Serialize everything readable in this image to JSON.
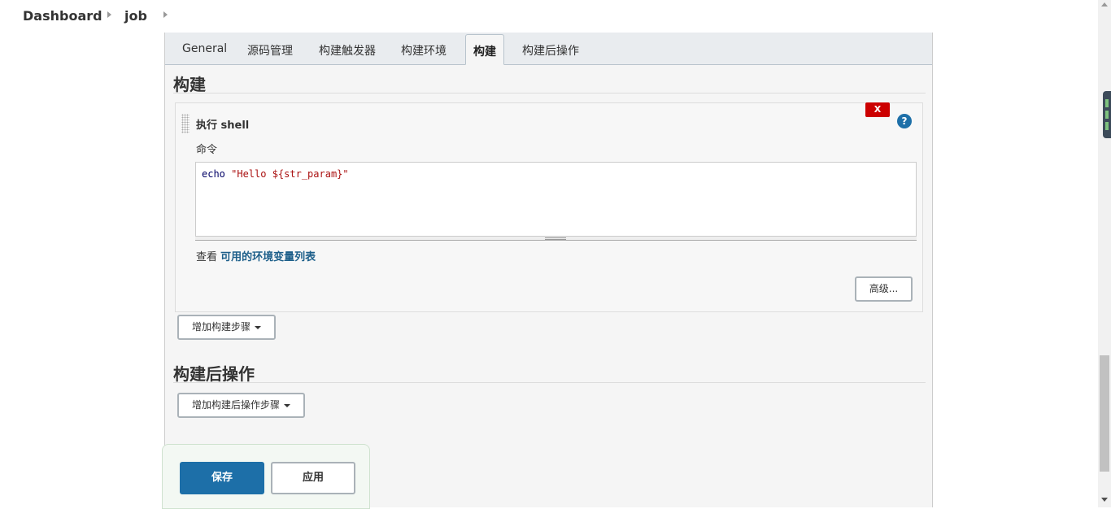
{
  "breadcrumb": {
    "items": [
      "Dashboard",
      "job"
    ]
  },
  "tabs": [
    {
      "label": "General"
    },
    {
      "label": "源码管理"
    },
    {
      "label": "构建触发器"
    },
    {
      "label": "构建环境"
    },
    {
      "label": "构建",
      "active": true
    },
    {
      "label": "构建后操作"
    }
  ],
  "build": {
    "section_title": "构建",
    "step": {
      "title": "执行 shell",
      "delete_label": "X",
      "help_label": "?",
      "command_label": "命令",
      "command_code": "echo ",
      "command_string": "\"Hello ${str_param}\"",
      "env_prefix": "查看 ",
      "env_link": "可用的环境变量列表",
      "advanced_label": "高级..."
    },
    "add_step_label": "增加构建步骤"
  },
  "post_build": {
    "section_title": "构建后操作",
    "add_step_label": "增加构建后操作步骤"
  },
  "actions": {
    "save_label": "保存",
    "apply_label": "应用"
  },
  "colors": {
    "primary": "#1d6fa8",
    "delete": "#cc0000",
    "link": "#1d5f8a",
    "panel_bg": "#f5f5f5"
  }
}
